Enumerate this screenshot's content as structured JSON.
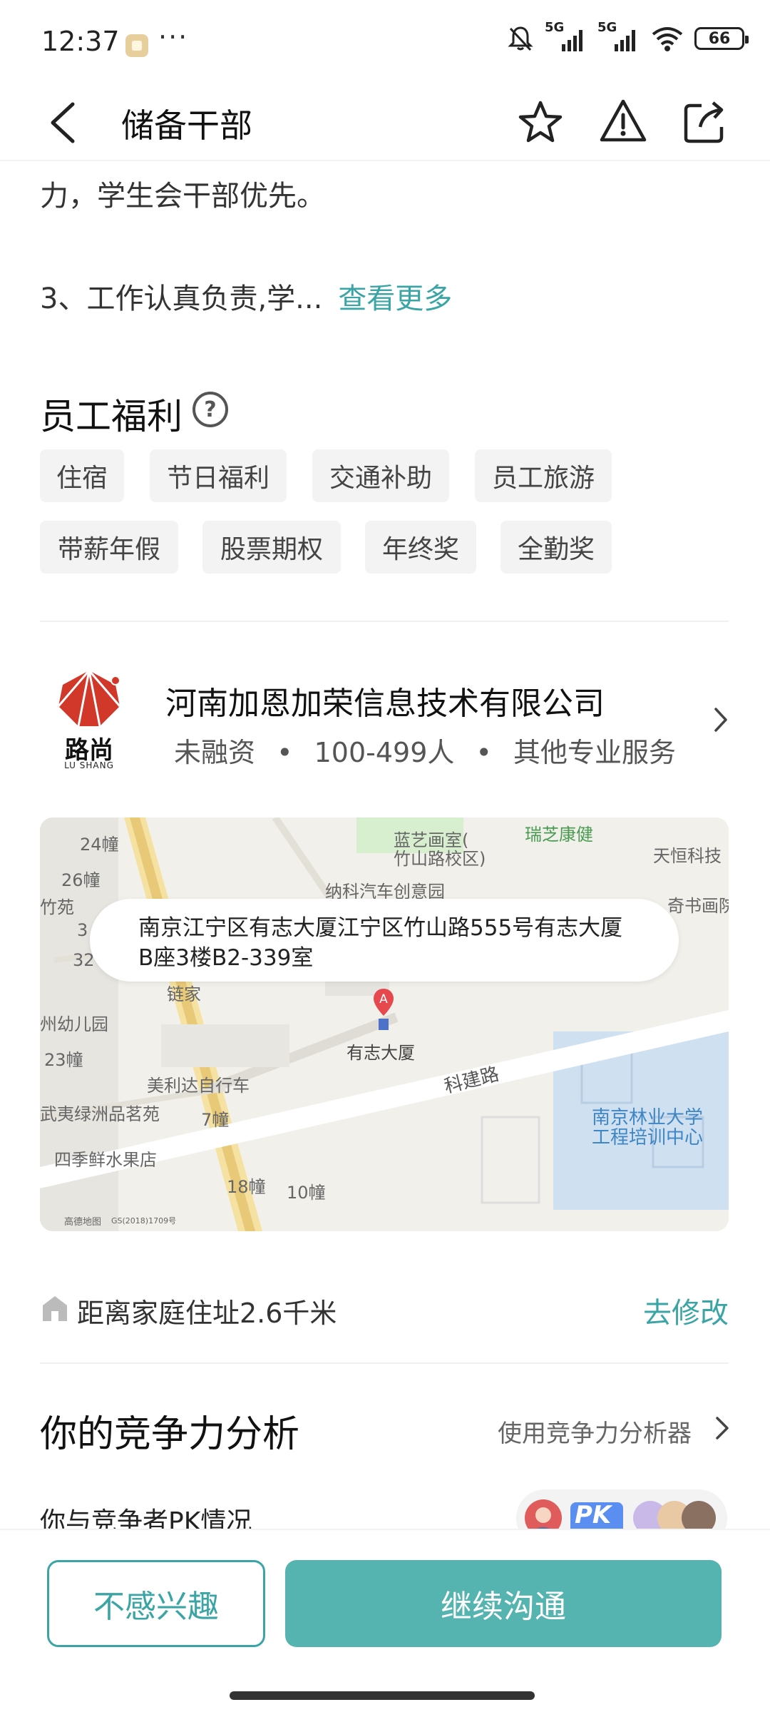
{
  "status_bar": {
    "time": "12:37",
    "more": "···",
    "network_1": "5G",
    "network_2": "5G",
    "battery": "66",
    "icons": [
      "app-notification-icon",
      "bell-off-icon",
      "signal-icon",
      "wifi-icon",
      "battery-icon"
    ]
  },
  "nav": {
    "title": "储备干部",
    "icons": [
      "back-icon",
      "star-icon",
      "report-icon",
      "share-icon"
    ]
  },
  "description": {
    "line1": "力，学生会干部优先。",
    "line2": "3、工作认真负责,学...",
    "see_more": "查看更多"
  },
  "benefits": {
    "title": "员工福利",
    "help": "?",
    "tags": [
      "住宿",
      "节日福利",
      "交通补助",
      "员工旅游",
      "带薪年假",
      "股票期权",
      "年终奖",
      "全勤奖"
    ]
  },
  "company": {
    "logo_text": "路尚",
    "logo_sub": "LU SHANG",
    "name": "河南加恩加荣信息技术有限公司",
    "funding": "未融资",
    "size": "100-499人",
    "industry": "其他专业服务",
    "separator": "•"
  },
  "map": {
    "address_line1": "南京江宁区有志大厦江宁区竹山路555号有志大厦",
    "address_line2": "B座3楼B2-339室",
    "pin_letter": "A",
    "labels": [
      "24幢",
      "26幢",
      "蓝艺画室(",
      "竹山路校区)",
      "瑞芝康健",
      "天恒科技",
      "纳科汽车创意园",
      "竹苑",
      "奇书画院",
      "链家",
      "州幼儿园",
      "有志大厦",
      "23幢",
      "美利达自行车",
      "科建路",
      "南京林业大学",
      "工程培训中心",
      "武夷绿洲品茗苑",
      "7幢",
      "四季鲜水果店",
      "18幢",
      "10幢",
      "高德地图",
      "GS(2018)1709号",
      "3",
      "32"
    ]
  },
  "distance": {
    "text": "距离家庭住址2.6千米",
    "action": "去修改"
  },
  "competition": {
    "title": "你的竞争力分析",
    "tool": "使用竞争力分析器",
    "pk_text": "你与竞争者PK情况",
    "pk_label": "PK"
  },
  "actions": {
    "not_interested": "不感兴趣",
    "continue": "继续沟通"
  },
  "colors": {
    "accent": "#3aa5a4",
    "primary_button": "#55b4b0",
    "tag_bg": "#f3f3f3",
    "logo_red": "#d2382a"
  }
}
